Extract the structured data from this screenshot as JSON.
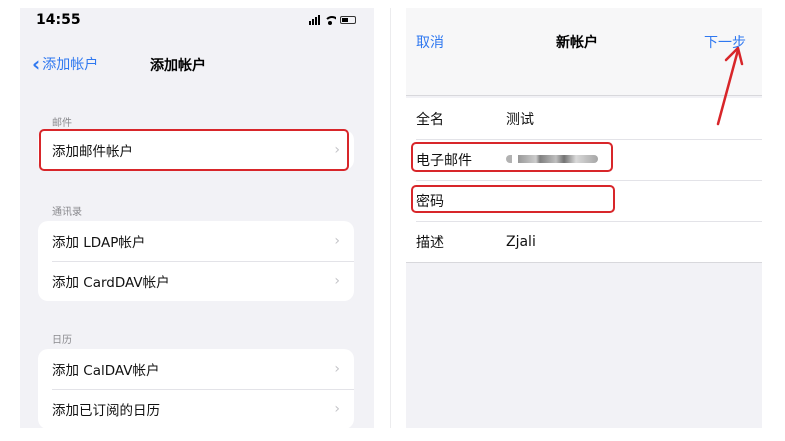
{
  "left": {
    "status": {
      "time": "14:55"
    },
    "nav": {
      "back_label": "添加帐户",
      "title": "添加帐户"
    },
    "sections": [
      {
        "label": "邮件",
        "items": [
          "添加邮件帐户"
        ]
      },
      {
        "label": "通讯录",
        "items": [
          "添加 LDAP帐户",
          "添加 CardDAV帐户"
        ]
      },
      {
        "label": "日历",
        "items": [
          "添加 CalDAV帐户",
          "添加已订阅的日历"
        ]
      }
    ]
  },
  "right": {
    "nav": {
      "cancel": "取消",
      "title": "新帐户",
      "next": "下一步"
    },
    "fields": [
      {
        "label": "全名",
        "value": "测试"
      },
      {
        "label": "电子邮件",
        "value": ""
      },
      {
        "label": "密码",
        "value": ""
      },
      {
        "label": "描述",
        "value": "Zjali"
      }
    ]
  },
  "colors": {
    "accent": "#2f78f0",
    "highlight": "#d8262a",
    "background": "#f2f2f6"
  },
  "icons": [
    "chevron-left-icon",
    "chevron-right-icon",
    "cellular-signal-icon",
    "wifi-icon",
    "battery-icon",
    "red-arrow-icon"
  ]
}
